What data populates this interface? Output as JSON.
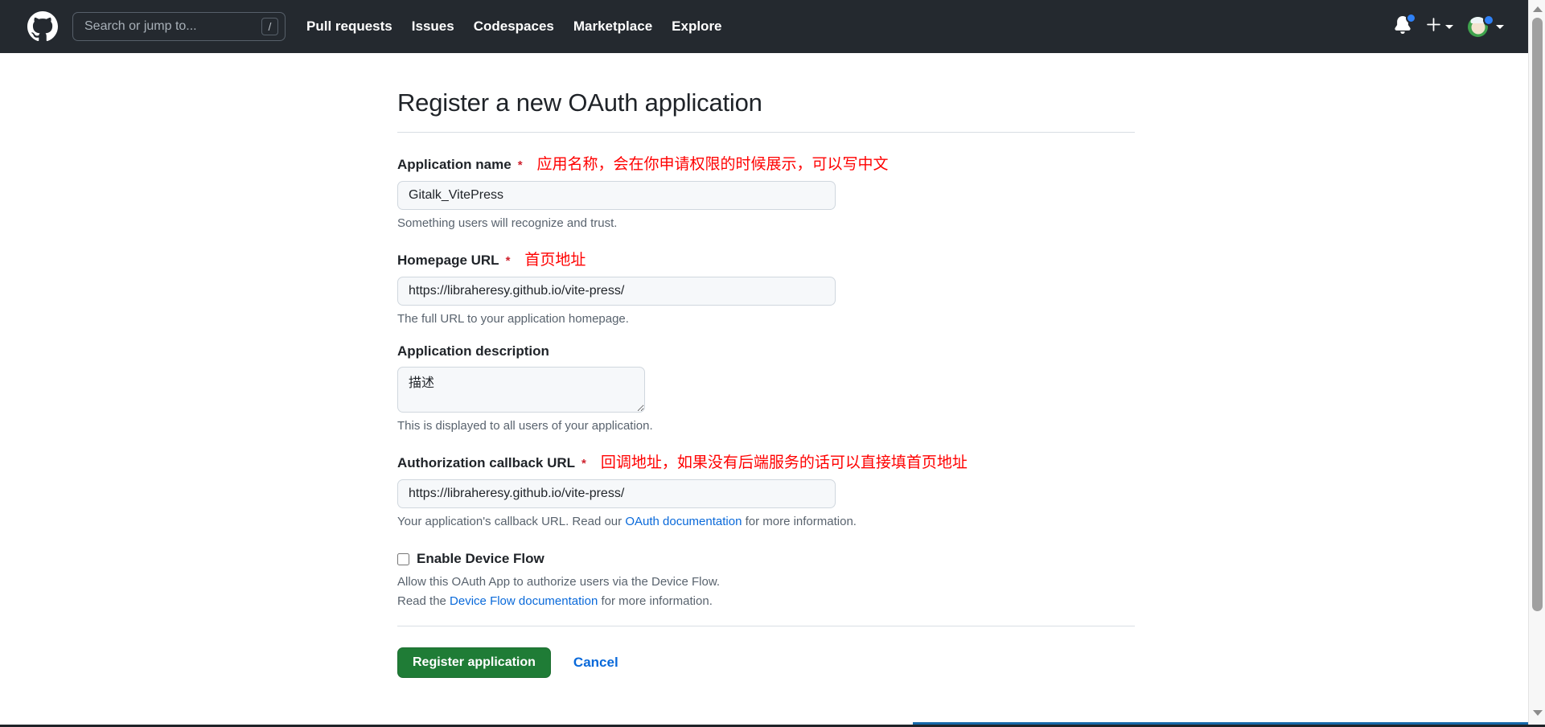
{
  "header": {
    "logo_icon": "github-mark-icon",
    "search": {
      "placeholder": "Search or jump to...",
      "value": "",
      "shortcut_badge": "/"
    },
    "nav": [
      {
        "label": "Pull requests"
      },
      {
        "label": "Issues"
      },
      {
        "label": "Codespaces"
      },
      {
        "label": "Marketplace"
      },
      {
        "label": "Explore"
      }
    ],
    "notifications_icon": "bell-icon",
    "create_new_icon": "plus-icon",
    "account_icon": "avatar-icon",
    "background_color": "#24292f"
  },
  "page": {
    "title": "Register a new OAuth application"
  },
  "fields": {
    "app_name": {
      "label": "Application name",
      "required_marker": "*",
      "annotation": "应用名称，会在你申请权限的时候展示，可以写中文",
      "value": "Gitalk_VitePress",
      "help": "Something users will recognize and trust."
    },
    "homepage_url": {
      "label": "Homepage URL",
      "required_marker": "*",
      "annotation": "首页地址",
      "value": "https://libraheresy.github.io/vite-press/",
      "help": "The full URL to your application homepage."
    },
    "app_description": {
      "label": "Application description",
      "required_marker": "",
      "annotation": "",
      "value": "描述",
      "help": "This is displayed to all users of your application."
    },
    "callback_url": {
      "label": "Authorization callback URL",
      "required_marker": "*",
      "annotation": "回调地址，如果没有后端服务的话可以直接填首页地址",
      "value": "https://libraheresy.github.io/vite-press/",
      "help_prefix": "Your application's callback URL. Read our ",
      "help_link": "OAuth documentation",
      "help_suffix": " for more information."
    },
    "device_flow": {
      "checkbox_label": "Enable Device Flow",
      "checked": false,
      "help_line1": "Allow this OAuth App to authorize users via the Device Flow.",
      "help_line2_prefix": "Read the ",
      "help_line2_link": "Device Flow documentation",
      "help_line2_suffix": " for more information."
    }
  },
  "actions": {
    "submit_label": "Register application",
    "cancel_label": "Cancel",
    "submit_color": "#1f7c36",
    "link_color": "#0969da"
  },
  "scrollbar": {
    "up_arrow_icon": "chevron-up-icon",
    "down_arrow_icon": "chevron-down-icon"
  },
  "colors": {
    "annotation_red": "#ff0000",
    "required_red": "#cf222e",
    "input_bg": "#f6f8fa",
    "border": "#d0d7de"
  }
}
